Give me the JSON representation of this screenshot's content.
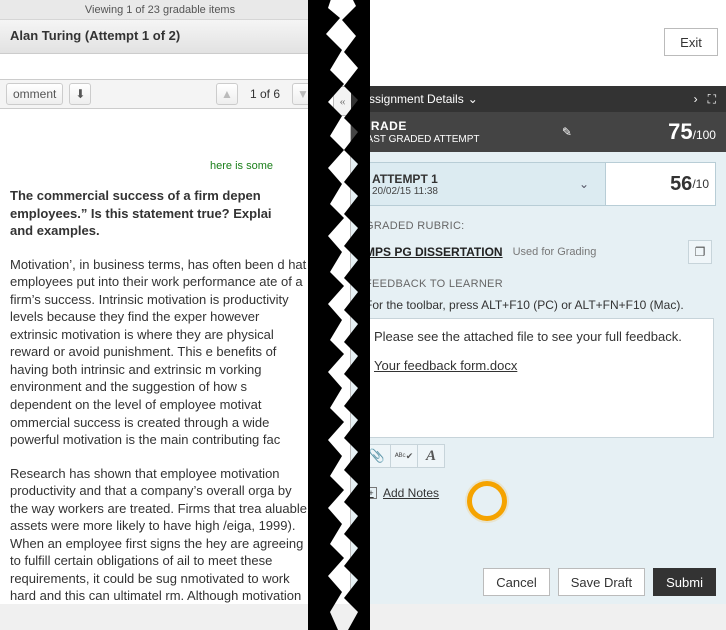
{
  "top": {
    "viewing_text": "Viewing 1 of 23 gradable items",
    "attempt_header": "Alan Turing (Attempt 1 of 2)",
    "exit_label": "Exit"
  },
  "doc_toolbar": {
    "comment_label": "omment",
    "download_icon": "⬇",
    "prev_page_icon": "▲",
    "page_label": "1 of 6",
    "next_page_icon": "▼"
  },
  "essay": {
    "green_note": "here is some",
    "question": "The commercial success of a firm depen\nemployees.” Is this statement true? Explai\nand examples.",
    "para1": "Motivation’, in business terms, has often been d hat employees put into their work performance ate of a firm’s success. Intrinsic motivation is  productivity levels because they find the exper however extrinsic motivation is where they are  physical reward or avoid punishment. This e benefits of having both intrinsic and extrinsic m vorking environment and the suggestion of how s dependent on the level of employee motivat ommercial success is created through a wide  powerful motivation is the main contributing fac",
    "para2": "Research has shown that employee motivation productivity and that a company’s overall orga by the way workers are treated. Firms that trea aluable assets were more likely to have high /eiga, 1999). When an employee first signs the hey are agreeing to fulfill certain obligations of ail to meet these requirements, it could be sug nmotivated to work hard and this can ultimatel rm. Although motivation is considered a key o"
  },
  "panel": {
    "title": "Assignment Details",
    "collapse_icon": "«",
    "nav_next_icon": "›",
    "nav_expand_icon": "⛶"
  },
  "grade": {
    "label_top": "GRADE",
    "label_sub": "LAST GRADED ATTEMPT",
    "pencil_icon": "✎",
    "score": "75",
    "score_max": "/100"
  },
  "attempt": {
    "label": "ATTEMPT 1",
    "timestamp": "20/02/15  11:38",
    "chevron_icon": "⌄",
    "score": "56",
    "score_max": "/10"
  },
  "rubric": {
    "section_title": "GRADED RUBRIC:",
    "name": "MPS PG DISSERTATION",
    "note": "Used for Grading",
    "open_icon": "❐"
  },
  "feedback": {
    "section_title": "FEEDBACK TO LEARNER",
    "hint": "For the toolbar, press ALT+F10 (PC) or ALT+FN+F10 (Mac).",
    "text": "Please see the attached file to see your full feedback.",
    "attachment": "Your feedback form.docx",
    "tool_attach_icon": "📎",
    "tool_spell_icon": "ᴬᴮᶜ✔",
    "tool_format_icon": "A"
  },
  "notes": {
    "icon": "+",
    "label": "Add Notes"
  },
  "buttons": {
    "cancel": "Cancel",
    "save_draft": "Save Draft",
    "submit": "Submi"
  }
}
